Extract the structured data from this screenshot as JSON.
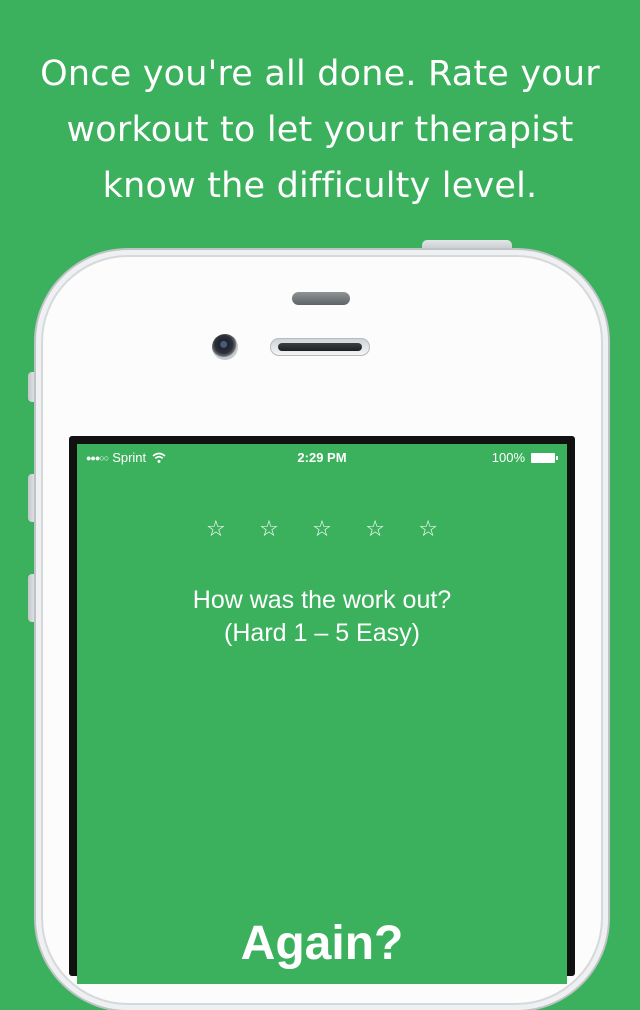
{
  "headline": {
    "line1": "Once you're all done. Rate your",
    "line2": "workout to let your therapist",
    "line3": "know the difficulty level."
  },
  "status_bar": {
    "signal": "●●●○○",
    "carrier": "Sprint",
    "time": "2:29 PM",
    "battery": "100%",
    "wifi_icon": "wifi-icon",
    "battery_icon": "battery-full-icon"
  },
  "rating": {
    "stars": [
      "☆",
      "☆",
      "☆",
      "☆",
      "☆"
    ],
    "selected": 0,
    "question_line1": "How was the work out?",
    "question_line2": "(Hard 1 – 5 Easy)"
  },
  "again_button": {
    "label": "Again?"
  },
  "colors": {
    "background": "#3cb15d",
    "text": "#ffffff",
    "phone_body": "#fcfcfc"
  }
}
